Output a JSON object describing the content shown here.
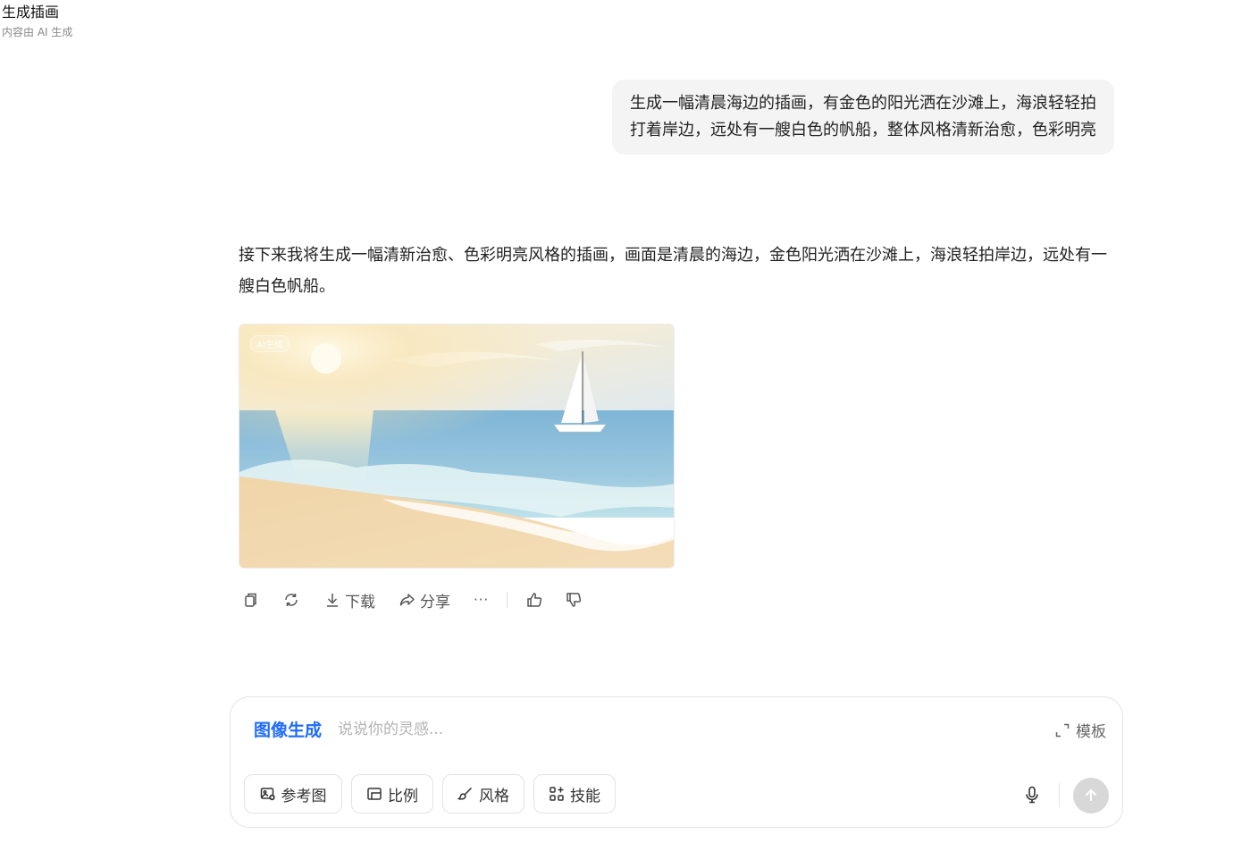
{
  "header": {
    "title": "生成插画",
    "subtitle": "内容由 AI 生成"
  },
  "conversation": {
    "user_message": "生成一幅清晨海边的插画，有金色的阳光洒在沙滩上，海浪轻轻拍打着岸边，远处有一艘白色的帆船，整体风格清新治愈，色彩明亮",
    "assistant_reply": "接下来我将生成一幅清新治愈、色彩明亮风格的插画，画面是清晨的海边，金色阳光洒在沙滩上，海浪轻拍岸边，远处有一艘白色帆船。",
    "image_watermark": "AI生成"
  },
  "actions": {
    "download_label": "下载",
    "share_label": "分享",
    "more_label": "···"
  },
  "composer": {
    "mode_label": "图像生成",
    "placeholder": "说说你的灵感...",
    "value": "",
    "template_label": "模板",
    "chips": {
      "reference": "参考图",
      "ratio": "比例",
      "style": "风格",
      "skills": "技能"
    }
  },
  "colors": {
    "accent": "#1f6bff",
    "bubble": "#f4f4f4",
    "send_disabled": "#d8d8d8"
  }
}
